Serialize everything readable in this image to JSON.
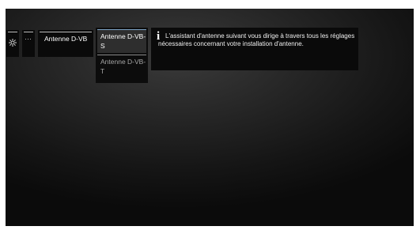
{
  "menu": {
    "gear_icon": "gear-icon",
    "more_label": "···",
    "antenna_label": "Antenne D-VB",
    "submenu": [
      {
        "label": "Antenne D-VB-S",
        "selected": true
      },
      {
        "label": "Antenne D-VB-T",
        "selected": false
      }
    ]
  },
  "info": {
    "icon": "i",
    "text": "L'assistant d'antenne suivant vous dirige à travers tous les réglages nécessaires concernant votre installation d'antenne."
  },
  "colors": {
    "panel_bg": "#0a0a0a",
    "selected_bg": "#2e2e2e",
    "selected_accent": "#7fa6c8",
    "text": "#ffffff",
    "muted_text": "#a6a6a6"
  }
}
